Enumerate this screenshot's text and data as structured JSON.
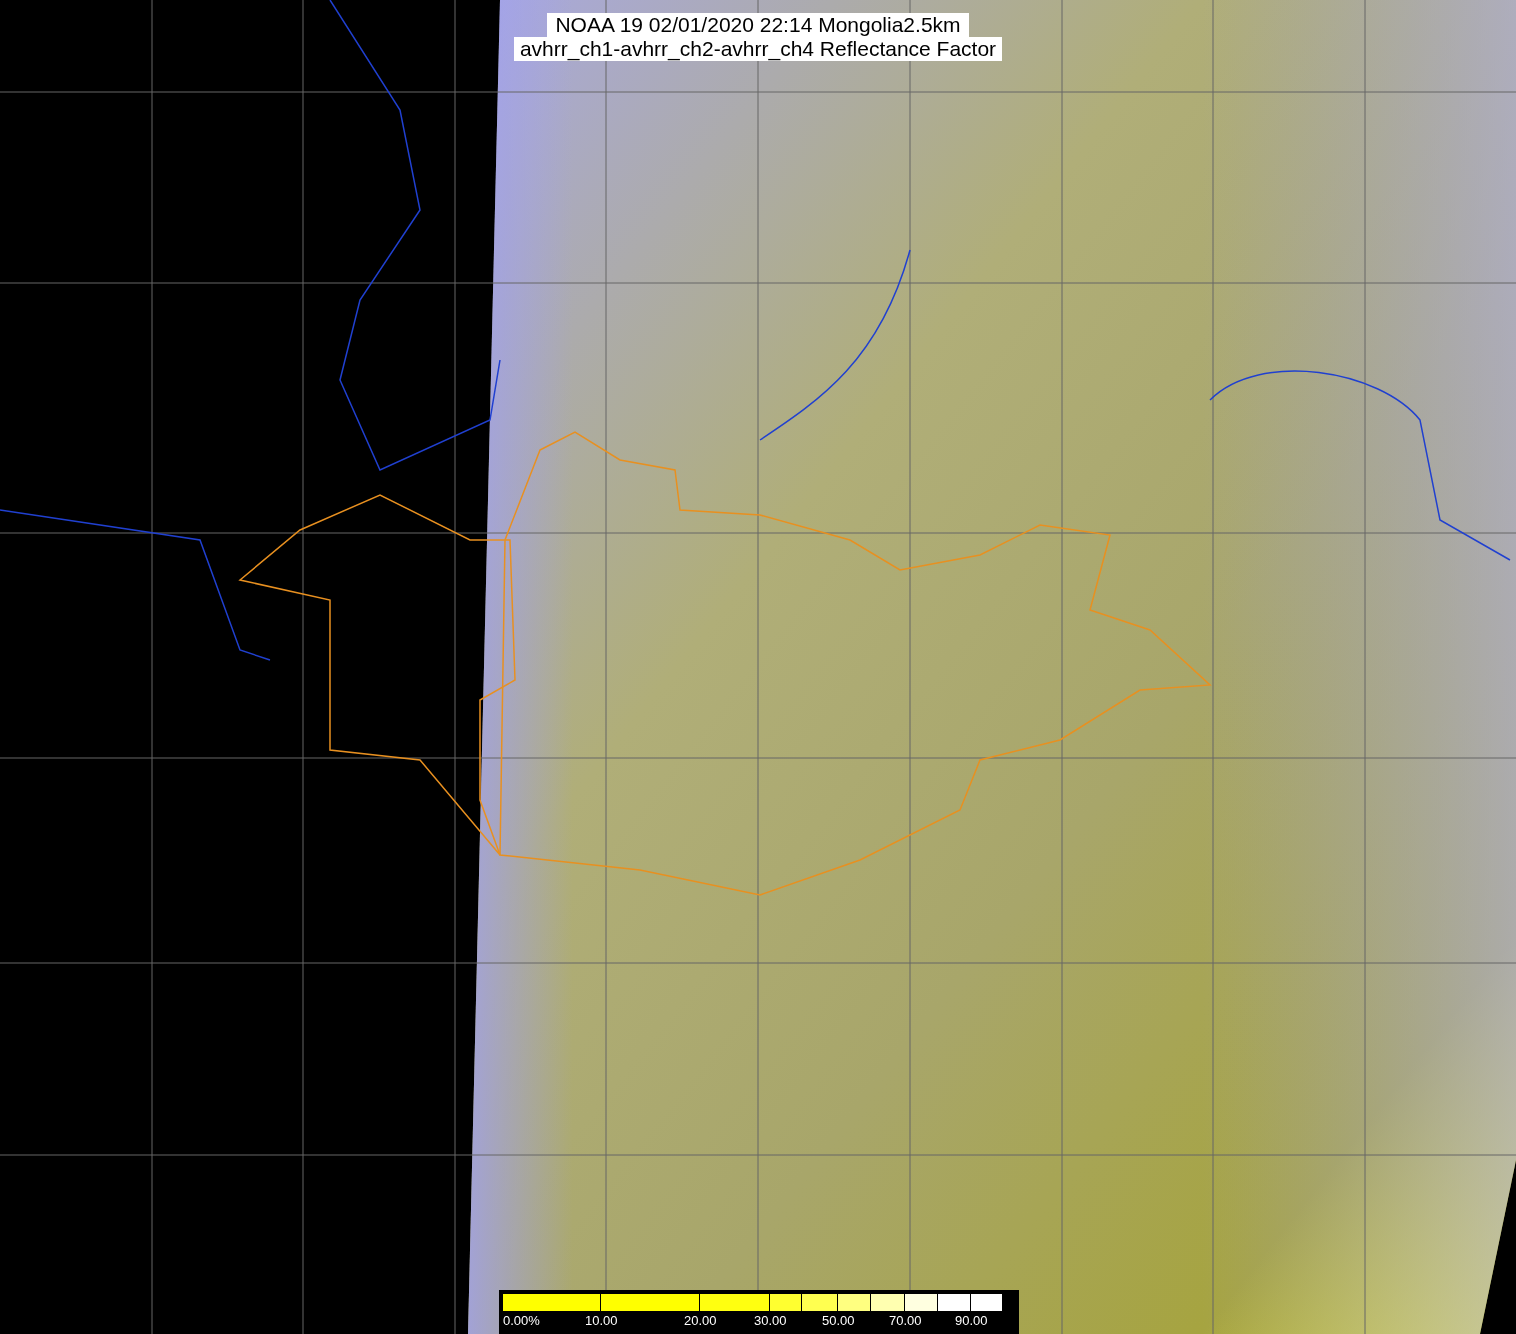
{
  "title": {
    "line_1": "NOAA 19 02/01/2020 22:14 Mongolia2.5km",
    "line_2": "avhrr_ch1-avhrr_ch2-avhrr_ch4 Reflectance Factor"
  },
  "colorbar": {
    "labels": [
      "0.00%",
      "10.00",
      "20.00",
      "30.00",
      "50.00",
      "70.00",
      "90.00"
    ]
  }
}
